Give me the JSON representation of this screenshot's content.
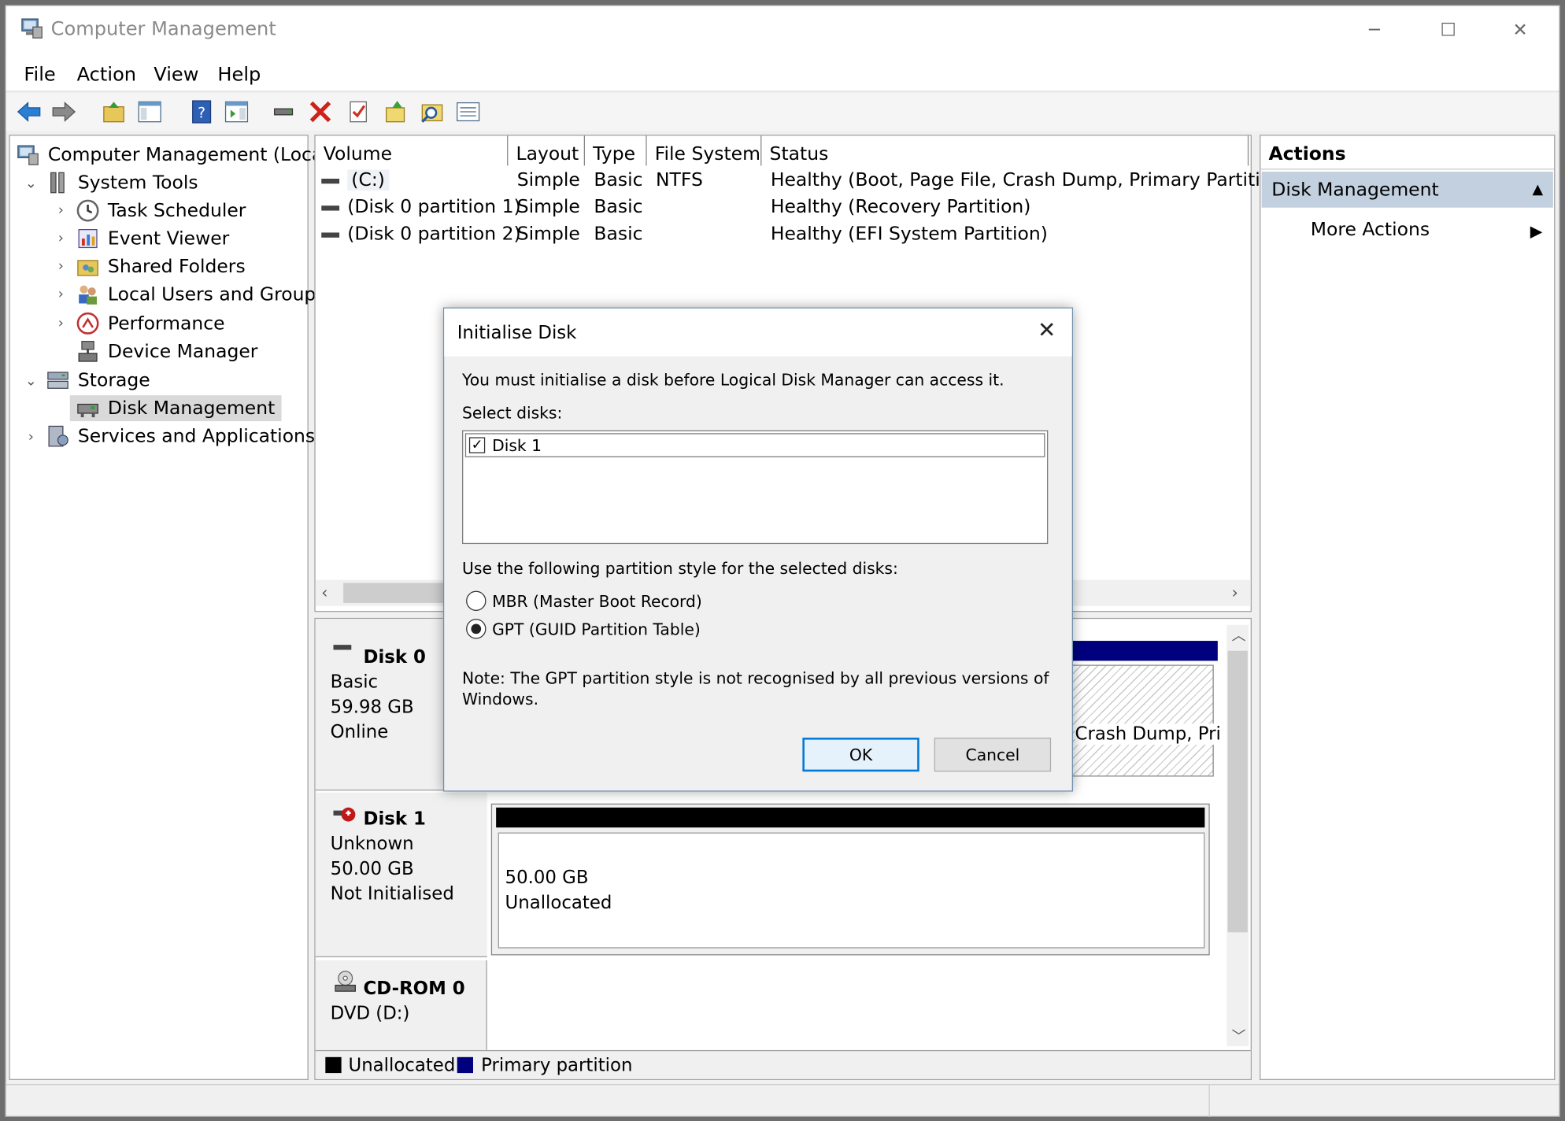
{
  "window": {
    "title": "Computer Management",
    "controls": {
      "minimize": "─",
      "maximize": "☐",
      "close": "✕"
    }
  },
  "menu": [
    "File",
    "Action",
    "View",
    "Help"
  ],
  "tree": {
    "root": "Computer Management (Local)",
    "system_tools": "System Tools",
    "task_scheduler": "Task Scheduler",
    "event_viewer": "Event Viewer",
    "shared_folders": "Shared Folders",
    "local_users": "Local Users and Groups",
    "performance": "Performance",
    "device_manager": "Device Manager",
    "storage": "Storage",
    "disk_management": "Disk Management",
    "services": "Services and Applications"
  },
  "volumes": {
    "headers": {
      "volume": "Volume",
      "layout": "Layout",
      "type": "Type",
      "fs": "File System",
      "status": "Status"
    },
    "rows": [
      {
        "volume": "(C:)",
        "layout": "Simple",
        "type": "Basic",
        "fs": "NTFS",
        "status": "Healthy (Boot, Page File, Crash Dump, Primary Partition)"
      },
      {
        "volume": "(Disk 0 partition 1)",
        "layout": "Simple",
        "type": "Basic",
        "fs": "",
        "status": "Healthy (Recovery Partition)"
      },
      {
        "volume": "(Disk 0 partition 2)",
        "layout": "Simple",
        "type": "Basic",
        "fs": "",
        "status": "Healthy (EFI System Partition)"
      }
    ]
  },
  "disks": {
    "disk0": {
      "name": "Disk 0",
      "type": "Basic",
      "size": "59.98 GB",
      "state": "Online",
      "partition_text": "Crash Dump, Pri"
    },
    "disk1": {
      "name": "Disk 1",
      "type": "Unknown",
      "size": "50.00 GB",
      "state": "Not Initialised",
      "part_size": "50.00 GB",
      "part_status": "Unallocated"
    },
    "cdrom0": {
      "name": "CD-ROM 0",
      "drive": "DVD (D:)"
    }
  },
  "legend": {
    "unallocated": "Unallocated",
    "primary": "Primary partition",
    "unallocated_color": "#000000",
    "primary_color": "#00007f"
  },
  "actions": {
    "header": "Actions",
    "section": "Disk Management",
    "more": "More Actions"
  },
  "dialog": {
    "title": "Initialise Disk",
    "intro": "You must initialise a disk before Logical Disk Manager can access it.",
    "select_label": "Select disks:",
    "disks": [
      {
        "label": "Disk 1",
        "checked": true
      }
    ],
    "style_label": "Use the following partition style for the selected disks:",
    "mbr": "MBR (Master Boot Record)",
    "gpt": "GPT (GUID Partition Table)",
    "selected_style": "GPT",
    "note_line1": "Note: The GPT partition style is not recognised by all previous versions of",
    "note_line2": "Windows.",
    "ok": "OK",
    "cancel": "Cancel"
  },
  "colors": {
    "selection": "#c3d0e0",
    "accent": "#0078d7"
  }
}
